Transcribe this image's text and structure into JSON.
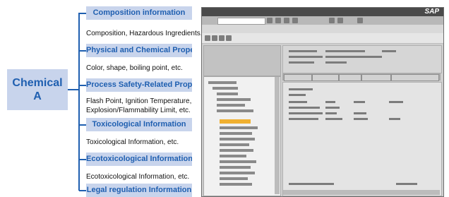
{
  "chemical": {
    "line1": "Chemical",
    "line2": "A"
  },
  "categories": [
    {
      "header": "Composition information",
      "description": "Composition, Hazardous Ingredients, etc."
    },
    {
      "header": "Physical and Chemical Properties",
      "description": "Color, shape, boiling point, etc."
    },
    {
      "header": "Process Safety-Related Properties",
      "description": "Flash Point, Ignition Temperature,",
      "description2": "Explosion/Flammability Limit, etc."
    },
    {
      "header": "Toxicological Information",
      "description": "Toxicological Information, etc."
    },
    {
      "header": "Ecotoxicological Information",
      "description": "Ecotoxicological Information, etc."
    },
    {
      "header": "Legal regulation Information"
    }
  ],
  "screenshot": {
    "logo": "SAP"
  },
  "colors": {
    "accent": "#1f5fb0",
    "box": "#c8d4ec"
  }
}
